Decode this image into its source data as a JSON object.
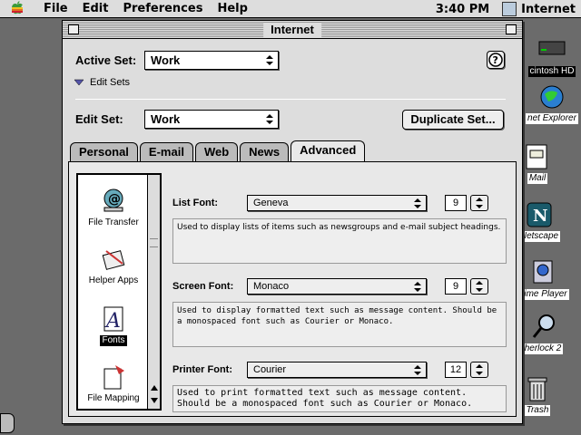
{
  "menubar": {
    "items": [
      "File",
      "Edit",
      "Preferences",
      "Help"
    ],
    "clock": "3:40 PM",
    "app_name": "Internet"
  },
  "desktop": {
    "icons": [
      {
        "label": "cintosh HD",
        "icon": "hard-disk-icon"
      },
      {
        "label": "net Explorer",
        "icon": "internet-explorer-icon"
      },
      {
        "label": "Mail",
        "icon": "mail-icon"
      },
      {
        "label": "Netscape",
        "icon": "netscape-icon"
      },
      {
        "label": "Time Player",
        "icon": "quicktime-icon"
      },
      {
        "label": "herlock 2",
        "icon": "sherlock-icon"
      },
      {
        "label": "Trash",
        "icon": "trash-icon"
      }
    ]
  },
  "window": {
    "title": "Internet",
    "active_set_label": "Active Set:",
    "active_set_value": "Work",
    "edit_sets_label": "Edit Sets",
    "edit_set_label": "Edit Set:",
    "edit_set_value": "Work",
    "duplicate_button": "Duplicate Set...",
    "tabs": [
      "Personal",
      "E-mail",
      "Web",
      "News",
      "Advanced"
    ],
    "active_tab": "Advanced",
    "sidebar": [
      {
        "label": "File Transfer",
        "icon": "file-transfer-icon",
        "selected": false
      },
      {
        "label": "Helper Apps",
        "icon": "helper-apps-icon",
        "selected": false
      },
      {
        "label": "Fonts",
        "icon": "fonts-icon",
        "selected": true
      },
      {
        "label": "File Mapping",
        "icon": "file-mapping-icon",
        "selected": false
      }
    ],
    "fonts": {
      "list": {
        "label": "List Font:",
        "font": "Geneva",
        "size": "9",
        "description": "Used to display lists of items such as newsgroups and e-mail subject headings."
      },
      "screen": {
        "label": "Screen Font:",
        "font": "Monaco",
        "size": "9",
        "description": "Used to display formatted text such as message content. Should be a monospaced font such as Courier or Monaco."
      },
      "printer": {
        "label": "Printer Font:",
        "font": "Courier",
        "size": "12",
        "description": "Used to print formatted text such as message content. Should be a monospaced font such as Courier or Monaco."
      }
    }
  }
}
